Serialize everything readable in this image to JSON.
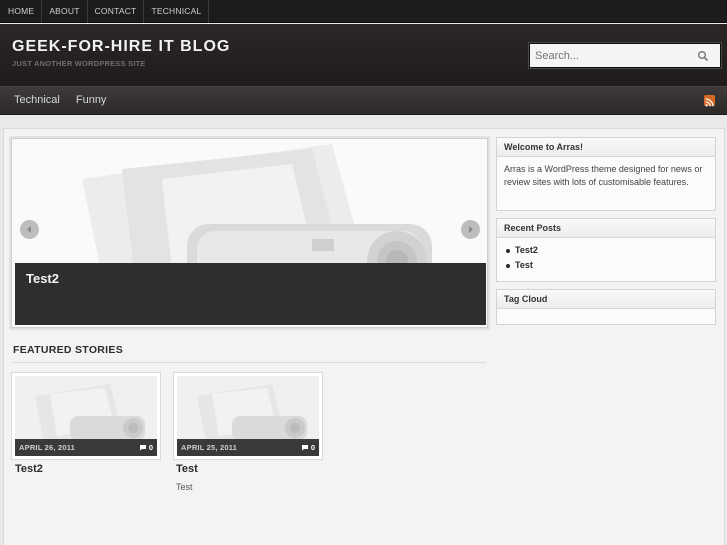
{
  "topnav": {
    "items": [
      "Home",
      "About",
      "Contact",
      "Technical"
    ]
  },
  "header": {
    "title": "GEEK-FOR-HIRE IT BLOG",
    "description": "JUST ANOTHER WORDPRESS SITE",
    "search_placeholder": "Search..."
  },
  "mainnav": {
    "items": [
      "Technical",
      "Funny"
    ],
    "rss_icon": "rss-icon"
  },
  "slideshow": {
    "title": "Test2"
  },
  "featured": {
    "heading": "FEATURED STORIES",
    "posts": [
      {
        "date": "APRIL 26, 2011",
        "comments": "0",
        "title": "Test2",
        "excerpt": ""
      },
      {
        "date": "APRIL 25, 2011",
        "comments": "0",
        "title": "Test",
        "excerpt": "Test"
      }
    ]
  },
  "sidebar": {
    "welcome": {
      "title": "Welcome to Arras!",
      "text": "Arras is a WordPress theme designed for news or review sites with lots of customisable features."
    },
    "recent": {
      "title": "Recent Posts",
      "items": [
        "Test2",
        "Test"
      ]
    },
    "tagcloud": {
      "title": "Tag Cloud"
    }
  },
  "colors": {
    "topbar": "#1c1c1c",
    "header": "#272423",
    "accent_rss": "#d66a25"
  }
}
